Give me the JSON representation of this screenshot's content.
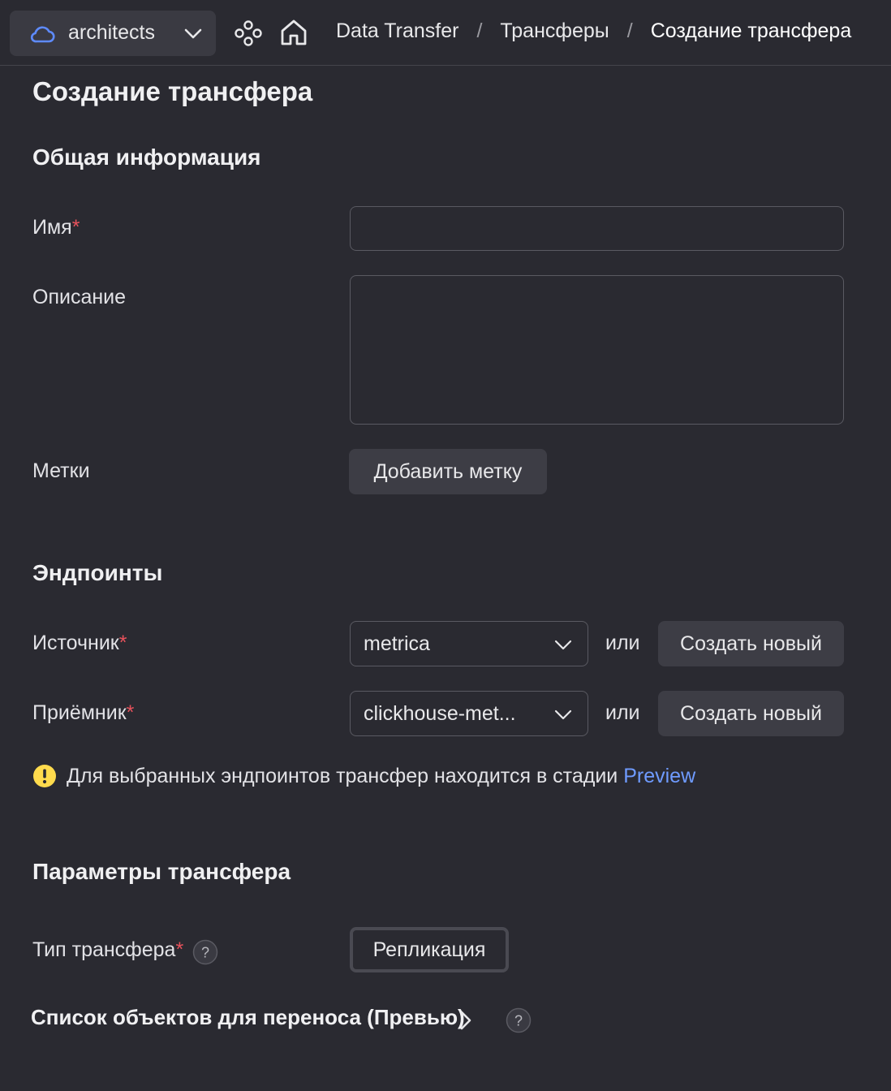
{
  "topbar": {
    "cloud_name": "architects",
    "breadcrumbs": [
      "Data Transfer",
      "Трансферы",
      "Создание трансфера"
    ]
  },
  "page_title": "Создание трансфера",
  "general": {
    "heading": "Общая информация",
    "name_label": "Имя",
    "name_value": "",
    "description_label": "Описание",
    "description_value": "",
    "labels_label": "Метки",
    "add_label_button": "Добавить метку"
  },
  "endpoints": {
    "heading": "Эндпоинты",
    "source_label": "Источник",
    "source_value": "metrica",
    "target_label": "Приёмник",
    "target_value": "clickhouse-met...",
    "or_text": "или",
    "create_new_button": "Создать новый",
    "notice_text": "Для выбранных эндпоинтов трансфер находится в стадии",
    "notice_link": "Preview"
  },
  "params": {
    "heading": "Параметры трансфера",
    "type_label": "Тип трансфера",
    "type_value": "Репликация",
    "objects_list_label": "Список объектов для переноса (Превью)"
  },
  "required_mark": "*",
  "colors": {
    "background": "#2a2a31",
    "required": "#e8525c",
    "link": "#6f9bff",
    "warning": "#ffdb4d",
    "accent_cloud": "#5e8bff"
  }
}
